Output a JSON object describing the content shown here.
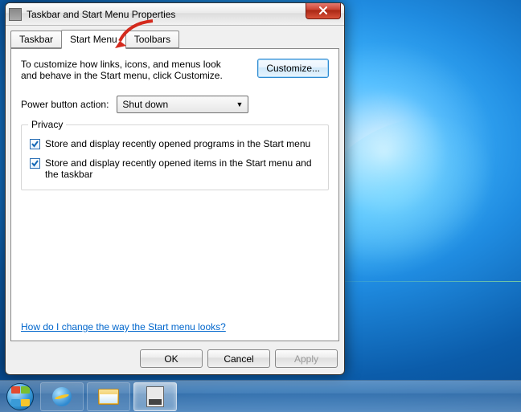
{
  "window": {
    "title": "Taskbar and Start Menu Properties"
  },
  "tabs": [
    "Taskbar",
    "Start Menu",
    "Toolbars"
  ],
  "startmenu_tab": {
    "description": "To customize how links, icons, and menus look and behave in the Start menu, click Customize.",
    "customize_btn": "Customize...",
    "power_label": "Power button action:",
    "power_value": "Shut down",
    "privacy": {
      "legend": "Privacy",
      "opt1": "Store and display recently opened programs in the Start menu",
      "opt2": "Store and display recently opened items in the Start menu and the taskbar"
    },
    "help_link": "How do I change the way the Start menu looks?"
  },
  "buttons": {
    "ok": "OK",
    "cancel": "Cancel",
    "apply": "Apply"
  }
}
